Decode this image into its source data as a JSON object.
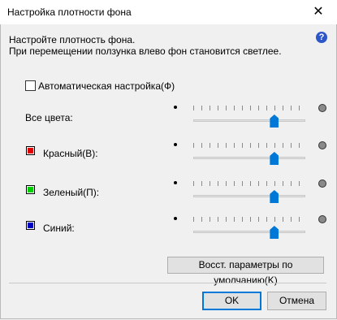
{
  "window": {
    "title": "Настройка плотности фона"
  },
  "instructions": {
    "line1": "Настройте плотность фона.",
    "line2": "При перемещении ползунка влево фон становится светлее."
  },
  "auto_setting": {
    "label": "Автоматическая настройка(Ф)",
    "checked": false
  },
  "sliders": [
    {
      "label": "Все цвета:",
      "value": 0.72,
      "color": null
    },
    {
      "label": "Красный(В):",
      "value": 0.72,
      "color": "#e00000"
    },
    {
      "label": "Зеленый(П):",
      "value": 0.72,
      "color": "#00d000"
    },
    {
      "label": "Синий:",
      "value": 0.72,
      "color": "#0000c0"
    }
  ],
  "buttons": {
    "restore_defaults": "Восст. параметры по умолчанию(K)",
    "ok": "OK",
    "cancel": "Отмена"
  },
  "icons": {
    "help": "help-icon",
    "close": "close-icon"
  }
}
